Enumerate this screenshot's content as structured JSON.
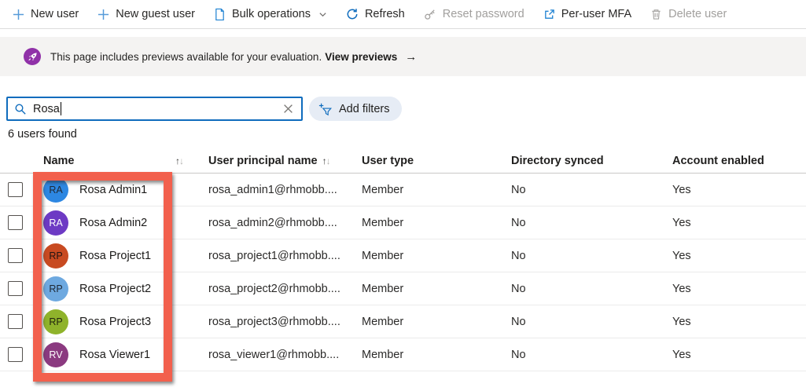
{
  "toolbar": {
    "items": [
      {
        "label": "New user",
        "icon": "plus-icon",
        "enabled": true,
        "has_dropdown": false
      },
      {
        "label": "New guest user",
        "icon": "plus-icon",
        "enabled": true,
        "has_dropdown": false
      },
      {
        "label": "Bulk operations",
        "icon": "document-icon",
        "enabled": true,
        "has_dropdown": true
      },
      {
        "label": "Refresh",
        "icon": "refresh-icon",
        "enabled": true,
        "has_dropdown": false
      },
      {
        "label": "Reset password",
        "icon": "key-icon",
        "enabled": false,
        "has_dropdown": false
      },
      {
        "label": "Per-user MFA",
        "icon": "external-link-icon",
        "enabled": true,
        "has_dropdown": false
      },
      {
        "label": "Delete user",
        "icon": "trash-icon",
        "enabled": false,
        "has_dropdown": false
      }
    ]
  },
  "banner": {
    "message": "This page includes previews available for your evaluation.",
    "link_label": "View previews",
    "arrow": "→",
    "icon_color": "#9031a8"
  },
  "search": {
    "value": "Rosa",
    "placeholder": ""
  },
  "filters": {
    "add_filters_label": "Add filters"
  },
  "results_count": "6 users found",
  "table": {
    "sort_icons": {
      "asc": "↑",
      "desc": "↓"
    },
    "columns": [
      {
        "label": "Name",
        "sortable": true
      },
      {
        "label": "User principal name",
        "sortable": true
      },
      {
        "label": "User type",
        "sortable": false
      },
      {
        "label": "Directory synced",
        "sortable": false
      },
      {
        "label": "Account enabled",
        "sortable": false
      }
    ],
    "rows": [
      {
        "initials": "RA",
        "avatar_color": "#2d87e2",
        "initials_color": "#1f2a38",
        "name": "Rosa Admin1",
        "upn": "rosa_admin1@rhmobb....",
        "user_type": "Member",
        "directory_synced": "No",
        "account_enabled": "Yes"
      },
      {
        "initials": "RA",
        "avatar_color": "#6d3ac4",
        "initials_color": "#ffffff",
        "name": "Rosa Admin2",
        "upn": "rosa_admin2@rhmobb....",
        "user_type": "Member",
        "directory_synced": "No",
        "account_enabled": "Yes"
      },
      {
        "initials": "RP",
        "avatar_color": "#c84a21",
        "initials_color": "#231512",
        "name": "Rosa Project1",
        "upn": "rosa_project1@rhmobb....",
        "user_type": "Member",
        "directory_synced": "No",
        "account_enabled": "Yes"
      },
      {
        "initials": "RP",
        "avatar_color": "#6ea9e0",
        "initials_color": "#1d2733",
        "name": "Rosa Project2",
        "upn": "rosa_project2@rhmobb....",
        "user_type": "Member",
        "directory_synced": "No",
        "account_enabled": "Yes"
      },
      {
        "initials": "RP",
        "avatar_color": "#8fb32b",
        "initials_color": "#22260e",
        "name": "Rosa Project3",
        "upn": "rosa_project3@rhmobb....",
        "user_type": "Member",
        "directory_synced": "No",
        "account_enabled": "Yes"
      },
      {
        "initials": "RV",
        "avatar_color": "#8b3a80",
        "initials_color": "#ffffff",
        "name": "Rosa Viewer1",
        "upn": "rosa_viewer1@rhmobb....",
        "user_type": "Member",
        "directory_synced": "No",
        "account_enabled": "Yes"
      }
    ]
  },
  "annotation": {
    "highlight_color": "#f2604d"
  }
}
